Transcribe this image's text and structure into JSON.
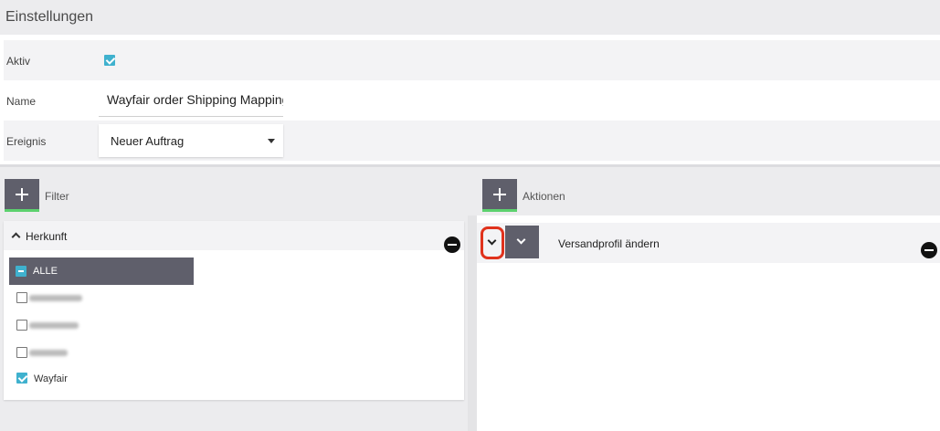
{
  "header": {
    "title": "Einstellungen"
  },
  "settings": {
    "aktiv_label": "Aktiv",
    "aktiv_checked": true,
    "name_label": "Name",
    "name_value": "Wayfair order Shipping Mapping",
    "ereignis_label": "Ereignis",
    "ereignis_value": "Neuer Auftrag"
  },
  "filter": {
    "add_icon": "plus-icon",
    "label": "Filter",
    "group": {
      "title": "Herkunft",
      "expanded": true,
      "all_label": "ALLE",
      "options": [
        {
          "label": "Wayfair",
          "checked": true
        }
      ]
    }
  },
  "actions": {
    "add_icon": "plus-icon",
    "label": "Aktionen",
    "items": [
      {
        "label": "Versandprofil ändern"
      }
    ]
  },
  "colors": {
    "accent_green": "#5cd16e",
    "checkbox_blue": "#3fb1ce",
    "dark_button": "#5f5f6b",
    "highlight_red": "#e0321c"
  }
}
